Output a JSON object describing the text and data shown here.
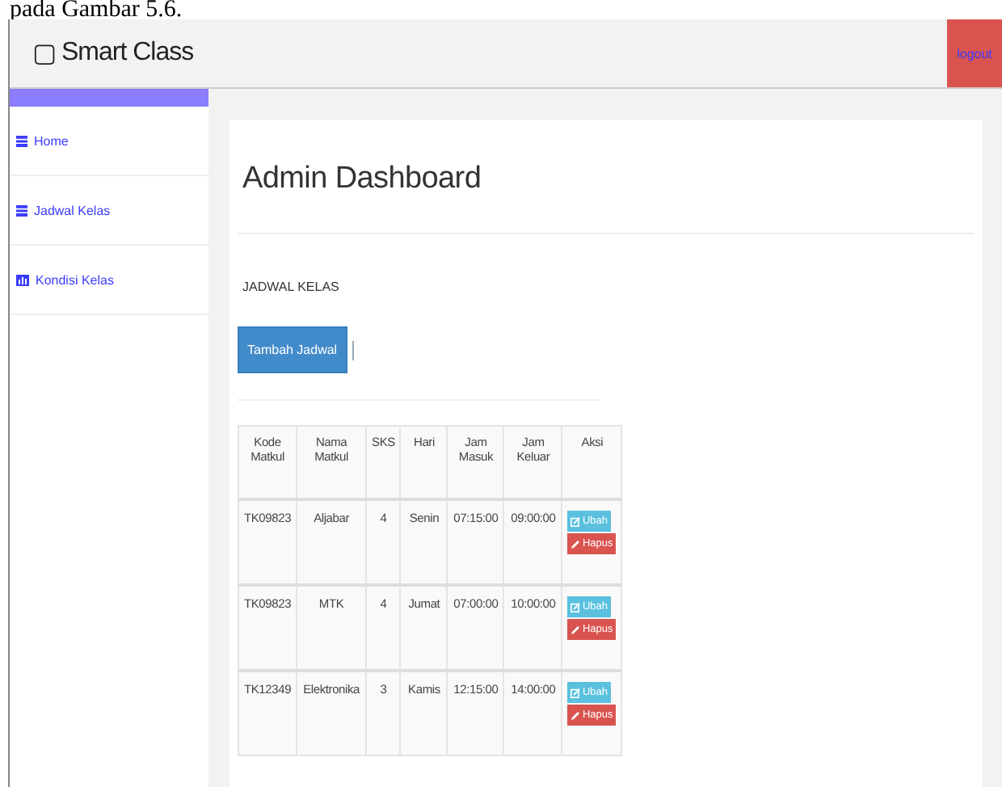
{
  "document_text": "pada Gambar 5.6.",
  "navbar": {
    "brand_icon": "▢",
    "brand": "Smart Class",
    "logout": "logout"
  },
  "sidebar": {
    "items": [
      {
        "label": "Home",
        "kind": "table"
      },
      {
        "label": "Jadwal Kelas",
        "kind": "table"
      },
      {
        "label": "Kondisi Kelas",
        "kind": "chart"
      }
    ]
  },
  "main": {
    "title": "Admin Dashboard",
    "section": "JADWAL KELAS",
    "add_button": "Tambah Jadwal"
  },
  "table": {
    "columns": [
      "Kode Matkul",
      "Nama Matkul",
      "SKS",
      "Hari",
      "Jam Masuk",
      "Jam Keluar",
      "Aksi"
    ],
    "rows": [
      {
        "cells": [
          "TK09823",
          "Aljabar",
          "4",
          "Senin",
          "07:15:00",
          "09:00:00"
        ],
        "actions": [
          "Ubah",
          "Hapus"
        ]
      },
      {
        "cells": [
          "TK09823",
          "MTK",
          "4",
          "Jumat",
          "07:00:00",
          "10:00:00"
        ],
        "actions": [
          "Ubah",
          "Hapus"
        ]
      },
      {
        "cells": [
          "TK12349",
          "Elektronika",
          "3",
          "Kamis",
          "12:15:00",
          "14:00:00"
        ],
        "actions": [
          "Ubah",
          "Hapus"
        ]
      }
    ]
  }
}
